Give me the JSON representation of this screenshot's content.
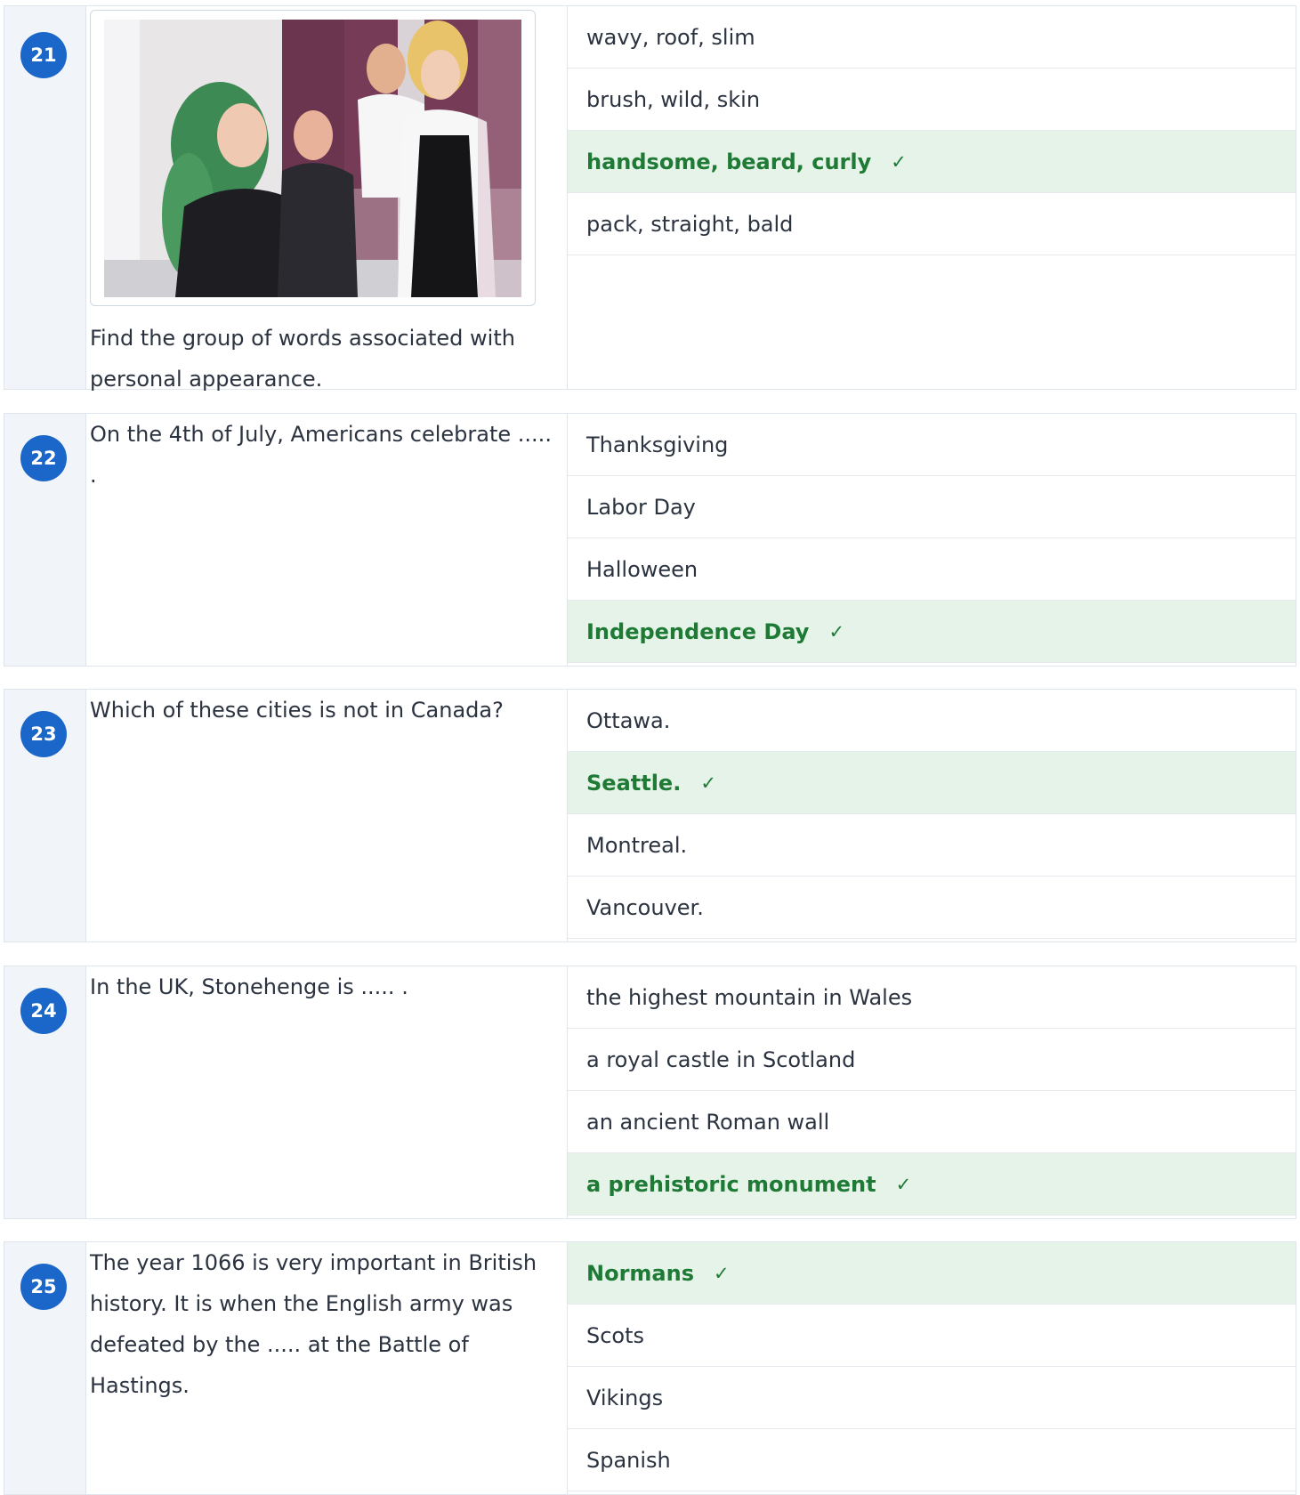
{
  "questions": [
    {
      "number": "21",
      "text": "Find the group of words associated with personal appearance.",
      "options": [
        {
          "label": "wavy, roof, slim",
          "correct": false
        },
        {
          "label": "brush, wild, skin",
          "correct": false
        },
        {
          "label": "handsome, beard, curly",
          "correct": true
        },
        {
          "label": "pack, straight, bald",
          "correct": false
        }
      ]
    },
    {
      "number": "22",
      "text": "On the 4th of July, Americans celebrate ..... .",
      "options": [
        {
          "label": "Thanksgiving",
          "correct": false
        },
        {
          "label": "Labor Day",
          "correct": false
        },
        {
          "label": "Halloween",
          "correct": false
        },
        {
          "label": "Independence Day",
          "correct": true
        }
      ]
    },
    {
      "number": "23",
      "text": "Which of these cities is not in Canada?",
      "options": [
        {
          "label": "Ottawa.",
          "correct": false
        },
        {
          "label": "Seattle.",
          "correct": true
        },
        {
          "label": "Montreal.",
          "correct": false
        },
        {
          "label": "Vancouver.",
          "correct": false
        }
      ]
    },
    {
      "number": "24",
      "text": "In the UK, Stonehenge is ..... .",
      "options": [
        {
          "label": "the highest mountain in Wales",
          "correct": false
        },
        {
          "label": "a royal castle in Scotland",
          "correct": false
        },
        {
          "label": "an ancient Roman wall",
          "correct": false
        },
        {
          "label": "a prehistoric monument",
          "correct": true
        }
      ]
    },
    {
      "number": "25",
      "text": "The year 1066 is very important in British history. It is when the English army was defeated by the ..... at the Battle of Hastings.",
      "options": [
        {
          "label": "Normans",
          "correct": true
        },
        {
          "label": "Scots",
          "correct": false
        },
        {
          "label": "Vikings",
          "correct": false
        },
        {
          "label": "Spanish",
          "correct": false
        }
      ]
    }
  ],
  "check_mark": "✓",
  "colors": {
    "badge": "#1a67c9",
    "correct_bg": "#e6f3e8",
    "correct_text": "#1e7a35",
    "number_column_bg": "#f1f4f9",
    "border": "#dfe5ec"
  }
}
